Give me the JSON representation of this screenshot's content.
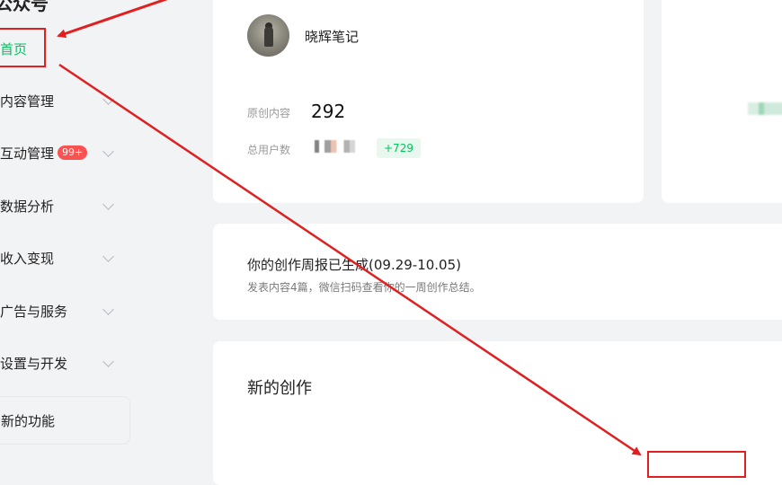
{
  "sidebar": {
    "title": "公众号",
    "items": [
      {
        "label": "首页"
      },
      {
        "label": "内容管理"
      },
      {
        "label": "互动管理",
        "badge": "99+"
      },
      {
        "label": "数据分析"
      },
      {
        "label": "收入变现"
      },
      {
        "label": "广告与服务"
      },
      {
        "label": "设置与开发"
      }
    ],
    "new_features": "新的功能"
  },
  "profile": {
    "name": "晓辉笔记",
    "original_label": "原创内容",
    "original_value": "292",
    "users_label": "总用户数",
    "users_growth": "+729"
  },
  "report": {
    "title": "你的创作周报已生成(09.29-10.05)",
    "subtitle": "发表内容4篇，微信扫码查看你的一周创作总结。"
  },
  "create": {
    "title": "新的创作"
  },
  "colors": {
    "accent": "#07c160",
    "badge": "#fa5151",
    "annotation": "#e02020"
  }
}
